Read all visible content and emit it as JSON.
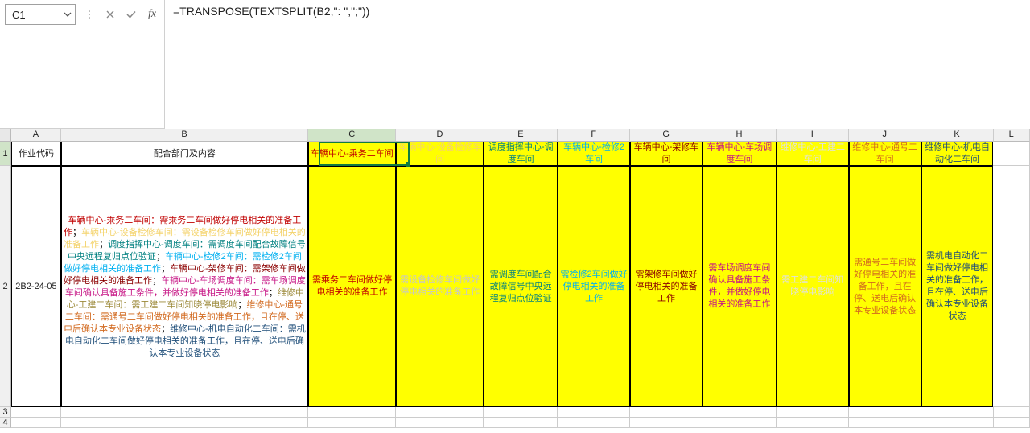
{
  "colors": {
    "accent": "#107c41",
    "grid": "#cccccc",
    "highlight": "#FFFF00"
  },
  "namebox": {
    "value": "C1"
  },
  "formula": {
    "text": "=TRANSPOSE(TEXTSPLIT(B2,\":  \",\";\"))"
  },
  "columns": [
    "A",
    "B",
    "C",
    "D",
    "E",
    "F",
    "G",
    "H",
    "I",
    "J",
    "K",
    "L"
  ],
  "rownums": [
    "1",
    "2",
    "3",
    "4"
  ],
  "active_col": "C",
  "active_row": "1",
  "header_row": {
    "A": "作业代码",
    "B": "配合部门及内容",
    "C": "车辆中心-乘务二车间",
    "D": "车辆中心-设备检修车间",
    "E": "调度指挥中心-调度车间",
    "F": "车辆中心-检修2车间",
    "G": "车辆中心-架修车间",
    "H": "车辆中心-车场调度车间",
    "I": "维修中心-工建二车间",
    "J": "维修中心-通号二车间",
    "K": "维修中心-机电自动化二车间"
  },
  "row2": {
    "A": "2B2-24-05",
    "B_segments": [
      {
        "cls": "t-red",
        "text": "车辆中心-乘务二车间：需乘务二车间做好停电相关的准备工作"
      },
      {
        "cls": "t-black",
        "text": "；"
      },
      {
        "cls": "t-ltyellow",
        "text": "车辆中心-设备检修车间：需设备检修车间做好停电相关的准备工作"
      },
      {
        "cls": "t-black",
        "text": "；"
      },
      {
        "cls": "t-teal",
        "text": "调度指挥中心-调度车间：需调度车间配合故障信号中央远程复归点位验证"
      },
      {
        "cls": "t-black",
        "text": "；"
      },
      {
        "cls": "t-cyan",
        "text": "车辆中心-检修2车间：需检修2车间做好停电相关的准备工作"
      },
      {
        "cls": "t-black",
        "text": "；"
      },
      {
        "cls": "t-darkred",
        "text": "车辆中心-架修车间：需架修车间做好停电相关的准备工作"
      },
      {
        "cls": "t-black",
        "text": "；"
      },
      {
        "cls": "t-magenta",
        "text": "车辆中心-车场调度车间：需车场调度车间确认具备施工条件，并做好停电相关的准备工作"
      },
      {
        "cls": "t-black",
        "text": "；"
      },
      {
        "cls": "t-olive",
        "text": "维修中心-工建二车间：需工建二车间知晓停电影响"
      },
      {
        "cls": "t-black",
        "text": "；"
      },
      {
        "cls": "t-orange",
        "text": "维修中心-通号二车间：需通号二车间做好停电相关的准备工作，且在停、送电后确认本专业设备状态"
      },
      {
        "cls": "t-black",
        "text": "；"
      },
      {
        "cls": "t-blue",
        "text": "维修中心-机电自动化二车间：需机电自动化二车间做好停电相关的准备工作，且在停、送电后确认本专业设备状态"
      }
    ],
    "C": "需乘务二车间做好停电相关的准备工作",
    "D": "需设备检修车间做好停电相关的准备工作",
    "E": "需调度车间配合故障信号中央远程复归点位验证",
    "F": "需检修2车间做好停电相关的准备工作",
    "G": "需架修车间做好停电相关的准备工作",
    "H": "需车场调度车间确认具备施工条件，并做好停电相关的准备工作",
    "I": "需工建二车间知晓停电影响",
    "J": "需通号二车间做好停电相关的准备工作，且在停、送电后确认本专业设备状态",
    "K": "需机电自动化二车间做好停电相关的准备工作，且在停、送电后确认本专业设备状态"
  }
}
